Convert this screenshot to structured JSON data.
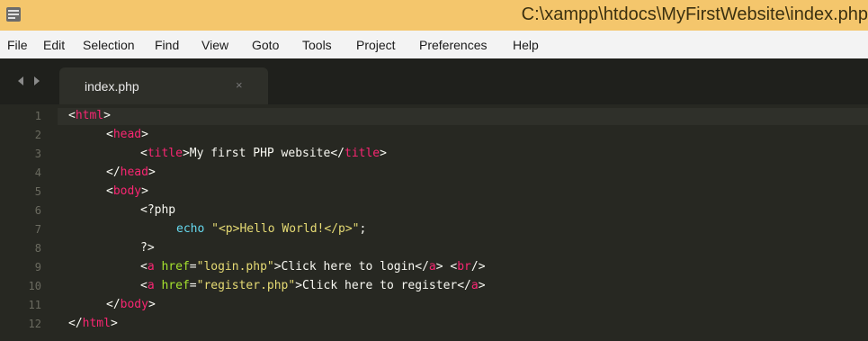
{
  "window": {
    "title": "C:\\xampp\\htdocs\\MyFirstWebsite\\index.php"
  },
  "menu": [
    "File",
    "Edit",
    "Selection",
    "Find",
    "View",
    "Goto",
    "Tools",
    "Project",
    "Preferences",
    "Help"
  ],
  "tab": {
    "label": "index.php",
    "close": "×"
  },
  "editor": {
    "line_numbers": [
      "1",
      "2",
      "3",
      "4",
      "5",
      "6",
      "7",
      "8",
      "9",
      "10",
      "11",
      "12"
    ]
  },
  "code": {
    "l1_open": "<",
    "l1_tag": "html",
    "l1_close": ">",
    "l2_open": "<",
    "l2_tag": "head",
    "l2_close": ">",
    "l3_open": "<",
    "l3_tag": "title",
    "l3_close": ">",
    "l3_text": "My first PHP website",
    "l3_open2": "</",
    "l3_tag2": "title",
    "l3_close2": ">",
    "l4_open": "</",
    "l4_tag": "head",
    "l4_close": ">",
    "l5_open": "<",
    "l5_tag": "body",
    "l5_close": ">",
    "l6_text": "<?php",
    "l7_kw": "echo",
    "l7_str": "\"<p>Hello World!</p>\"",
    "l7_end": ";",
    "l8_text": "?>",
    "l9_open": "<",
    "l9_tag": "a",
    "l9_attr": "href",
    "l9_eq": "=",
    "l9_val": "\"login.php\"",
    "l9_gt": ">",
    "l9_text": "Click here to login",
    "l9_cl_open": "</",
    "l9_cl_tag": "a",
    "l9_cl_close": ">",
    "l9_br_open": "<",
    "l9_br_tag": "br",
    "l9_br_close": "/>",
    "l10_open": "<",
    "l10_tag": "a",
    "l10_attr": "href",
    "l10_eq": "=",
    "l10_val": "\"register.php\"",
    "l10_gt": ">",
    "l10_text": "Click here to register",
    "l10_cl_open": "</",
    "l10_cl_tag": "a",
    "l10_cl_close": ">",
    "l11_open": "</",
    "l11_tag": "body",
    "l11_close": ">",
    "l12_open": "</",
    "l12_tag": "html",
    "l12_close": ">"
  },
  "colors": {
    "titlebar": "#f4c66c",
    "editor_bg": "#272822",
    "tag": "#f92672",
    "string": "#e6db74",
    "keyword": "#66d9ef"
  }
}
